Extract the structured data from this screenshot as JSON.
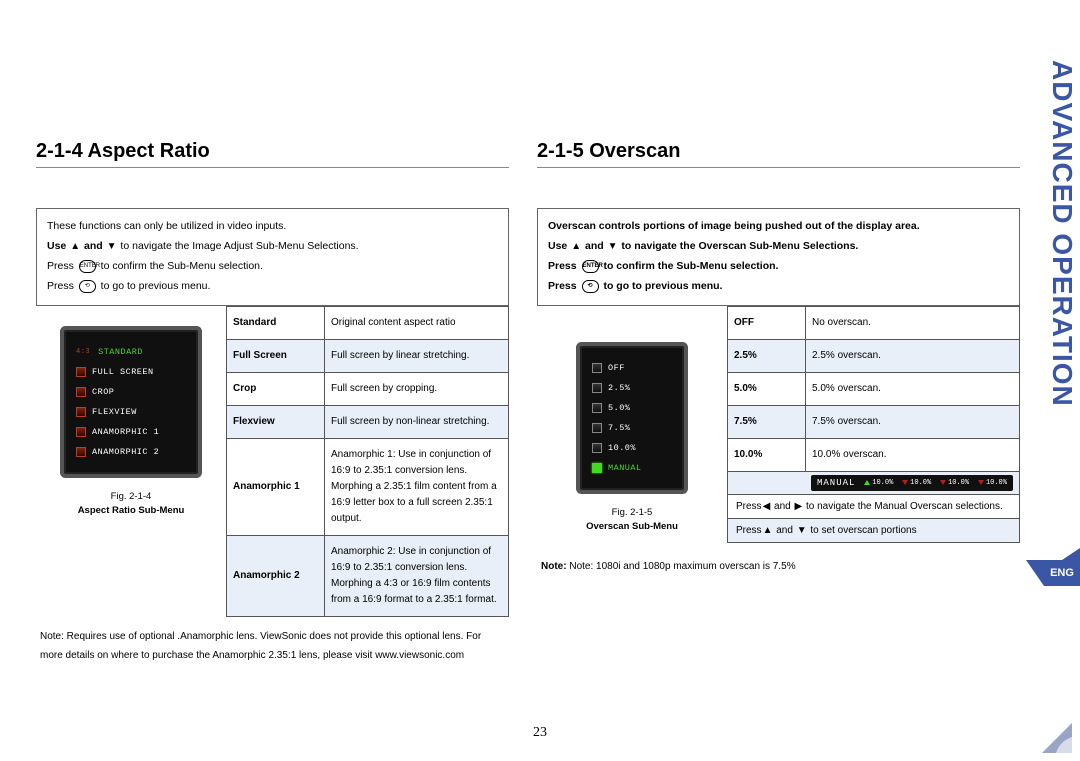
{
  "sideTitle": "ADVANCED OPERATION",
  "langTab": "ENG",
  "pageNum": "23",
  "left": {
    "heading": "2-1-4 Aspect Ratio",
    "intro": {
      "l1": "These functions can only be utilized in video inputs.",
      "l2a": "Use ",
      "l2b": " and ",
      "l2c": " to navigate the Image Adjust Sub-Menu Selections.",
      "l3a": "Press ",
      "l3b": " to confirm the Sub-Menu selection.",
      "l4a": "Press ",
      "l4b": " to go to previous menu."
    },
    "fig": {
      "ratio": "4:3",
      "items": [
        "STANDARD",
        "FULL SCREEN",
        "CROP",
        "FLEXVIEW",
        "ANAMORPHIC 1",
        "ANAMORPHIC 2"
      ],
      "capA": "Fig. 2-1-4",
      "capB": "Aspect Ratio Sub-Menu"
    },
    "rows": [
      {
        "lbl": "Standard",
        "desc": "Original content aspect ratio"
      },
      {
        "lbl": "Full Screen",
        "desc": "Full screen by linear stretching."
      },
      {
        "lbl": "Crop",
        "desc": "Full screen by cropping."
      },
      {
        "lbl": "Flexview",
        "desc": "Full screen by non-linear stretching."
      },
      {
        "lbl": "Anamorphic 1",
        "desc": "Anamorphic 1: Use in conjunction of 16:9 to 2.35:1 conversion lens. Morphing a 2.35:1 film content from a 16:9 letter box to a full screen 2.35:1 output."
      },
      {
        "lbl": "Anamorphic 2",
        "desc": "Anamorphic 2: Use in conjunction of 16:9 to 2.35:1 conversion lens. Morphing a 4:3 or 16:9 film contents from a 16:9 format to a 2.35:1 format."
      }
    ],
    "note": "Note: Requires use of optional .Anamorphic lens. ViewSonic does not provide this optional lens. For more details on where to purchase the Anamorphic 2.35:1 lens, please visit www.viewsonic.com"
  },
  "right": {
    "heading": "2-1-5 Overscan",
    "intro": {
      "l1": "Overscan controls portions of image being pushed out of the display area.",
      "l2a": "Use ",
      "l2b": " and ",
      "l2c": " to navigate the Overscan Sub-Menu Selections.",
      "l3a": "Press ",
      "l3b": " to confirm the Sub-Menu selection.",
      "l4a": "Press ",
      "l4b": " to go to previous menu."
    },
    "fig": {
      "items": [
        "OFF",
        "2.5%",
        "5.0%",
        "7.5%",
        "10.0%",
        "MANUAL"
      ],
      "capA": "Fig. 2-1-5",
      "capB": "Overscan Sub-Menu"
    },
    "rows": [
      {
        "lbl": "OFF",
        "desc": "No overscan."
      },
      {
        "lbl": "2.5%",
        "desc": "2.5% overscan."
      },
      {
        "lbl": "5.0%",
        "desc": "5.0% overscan."
      },
      {
        "lbl": "7.5%",
        "desc": "7.5% overscan."
      },
      {
        "lbl": "10.0%",
        "desc": "10.0% overscan."
      }
    ],
    "manualBar": {
      "title": "MANUAL",
      "vals": [
        "10.0%",
        "10.0%",
        "10.0%",
        "10.0%"
      ]
    },
    "nav1a": "Press",
    "nav1b": " and ",
    "nav1c": " to navigate the Manual Overscan selections.",
    "nav2a": "Press",
    "nav2b": " and ",
    "nav2c": " to set overscan portions",
    "note": "Note: 1080i and 1080p maximum overscan is 7.5%"
  }
}
